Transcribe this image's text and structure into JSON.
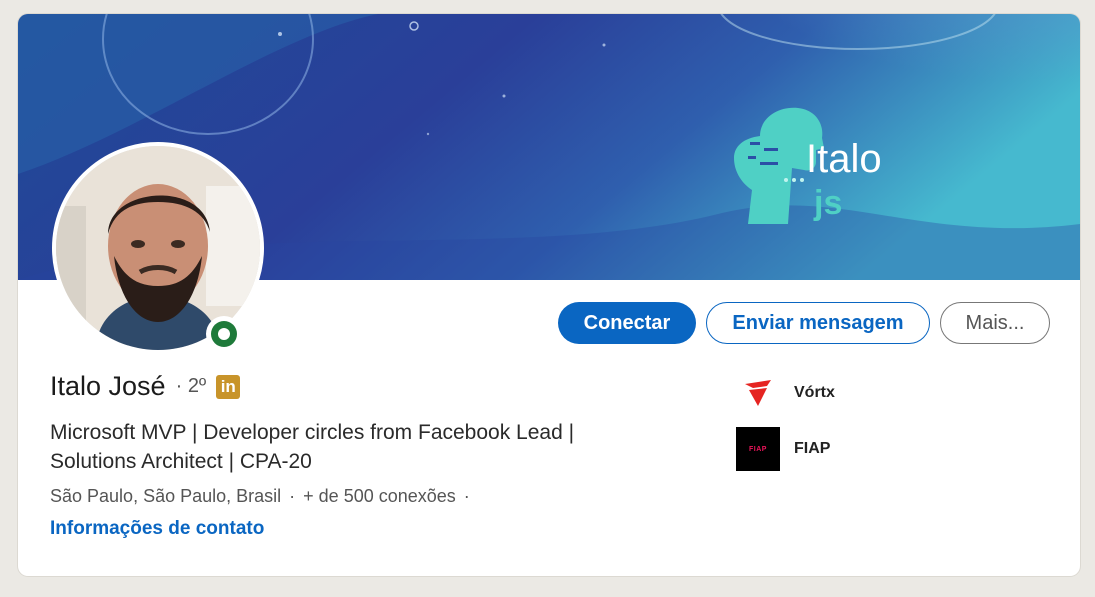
{
  "banner": {
    "brand_primary": "Italo",
    "brand_secondary": "js",
    "gradient_start": "#223a8c",
    "gradient_end": "#43b7cc",
    "accent": "#4fd0c5"
  },
  "profile": {
    "name": "Italo José",
    "degree": "2º",
    "badge": "in",
    "headline_line1": "Microsoft MVP | Developer circles from Facebook Lead |",
    "headline_line2": "Solutions Architect | CPA-20",
    "location": "São Paulo, São Paulo, Brasil",
    "separator": "·",
    "connections": "+ de 500 conexões",
    "contact_link": "Informações de contato"
  },
  "actions": {
    "connect_label": "Conectar",
    "message_label": "Enviar mensagem",
    "more_label": "Mais..."
  },
  "companies": [
    {
      "name": "Vórtx",
      "icon": "vortx-logo"
    },
    {
      "name": "FIAP",
      "icon": "fiap-logo",
      "logo_text": "FIAP"
    }
  ],
  "colors": {
    "primary_blue": "#0a66c2",
    "online_green": "#1e7a3a",
    "linkedin_badge": "#c8942a"
  }
}
